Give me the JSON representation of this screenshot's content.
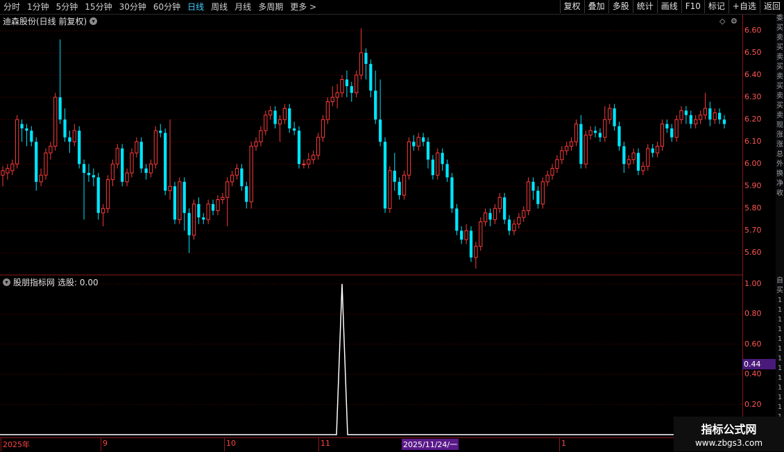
{
  "toolbar": {
    "periods": [
      "分时",
      "1分钟",
      "5分钟",
      "15分钟",
      "30分钟",
      "60分钟",
      "日线",
      "周线",
      "月线",
      "多周期",
      "更多"
    ],
    "active_period": "日线",
    "more_arrow": ">",
    "buttons": [
      "复权",
      "叠加",
      "多股",
      "统计",
      "画线",
      "F10",
      "标记",
      "+自选",
      "返回"
    ]
  },
  "main_chart": {
    "title": "迪森股份(日线 前复权)",
    "y_ticks": [
      "6.60",
      "6.50",
      "6.40",
      "6.30",
      "6.20",
      "6.10",
      "6.00",
      "5.90",
      "5.80",
      "5.70",
      "5.60"
    ]
  },
  "sub_chart": {
    "title": "股朋指标网",
    "indicator_label": "选股: 0.00",
    "y_ticks": [
      "1.00",
      "0.80",
      "0.60",
      "0.40",
      "0.20"
    ],
    "current_value": "0.44"
  },
  "x_axis": {
    "labels": [
      {
        "text": "2025年"
      },
      {
        "text": "9"
      },
      {
        "text": "10"
      },
      {
        "text": "11"
      },
      {
        "text": "1"
      }
    ],
    "selected_date": "2025/11/24/一"
  },
  "sidebar": {
    "chars": [
      "委",
      "买",
      "卖",
      "买",
      "卖",
      "买",
      "卖",
      "买",
      "卖",
      "买",
      "卖",
      "现",
      "涨",
      "涨",
      "总",
      "外",
      "换",
      "净",
      "收"
    ],
    "sub_chars": [
      "自",
      "买",
      "1",
      "1",
      "1",
      "1",
      "1",
      "1",
      "1",
      "1",
      "1",
      "1",
      "1",
      "1",
      "1",
      "1",
      "1"
    ]
  },
  "watermark": {
    "title": "指标公式网",
    "url": "www.zbgs3.com"
  },
  "colors": {
    "up": "#ff3b3b",
    "down": "#00e5ff",
    "signal": "#ffffff",
    "grid": "#6b0000"
  },
  "chart_data": {
    "type": "candlestick",
    "y_range": [
      5.52,
      6.65
    ],
    "candles": [
      [
        5.95,
        5.97,
        5.9,
        5.99
      ],
      [
        5.96,
        5.98,
        5.93,
        6.0
      ],
      [
        5.97,
        6.0,
        5.95,
        6.02
      ],
      [
        6.0,
        6.2,
        5.98,
        6.22
      ],
      [
        6.18,
        6.16,
        6.1,
        6.2
      ],
      [
        6.16,
        6.15,
        6.08,
        6.18
      ],
      [
        6.15,
        6.1,
        6.08,
        6.17
      ],
      [
        6.1,
        5.92,
        5.88,
        6.12
      ],
      [
        5.92,
        5.95,
        5.9,
        5.98
      ],
      [
        5.95,
        6.05,
        5.93,
        6.07
      ],
      [
        6.05,
        6.08,
        6.02,
        6.1
      ],
      [
        6.08,
        6.3,
        6.06,
        6.32
      ],
      [
        6.3,
        6.2,
        6.18,
        6.56
      ],
      [
        6.2,
        6.12,
        6.1,
        6.25
      ],
      [
        6.12,
        6.1,
        6.05,
        6.15
      ],
      [
        6.1,
        6.15,
        6.08,
        6.18
      ],
      [
        6.15,
        6.0,
        5.98,
        6.17
      ],
      [
        6.0,
        5.96,
        5.75,
        6.02
      ],
      [
        5.96,
        5.95,
        5.92,
        6.0
      ],
      [
        5.95,
        5.94,
        5.9,
        5.98
      ],
      [
        5.94,
        5.78,
        5.75,
        5.96
      ],
      [
        5.78,
        5.8,
        5.72,
        5.82
      ],
      [
        5.8,
        5.93,
        5.78,
        5.95
      ],
      [
        5.93,
        6.0,
        5.9,
        6.02
      ],
      [
        6.0,
        6.07,
        5.98,
        6.09
      ],
      [
        6.07,
        5.92,
        5.9,
        6.09
      ],
      [
        5.92,
        5.96,
        5.9,
        5.98
      ],
      [
        5.96,
        6.05,
        5.94,
        6.07
      ],
      [
        6.05,
        6.1,
        6.03,
        6.12
      ],
      [
        6.1,
        5.98,
        5.96,
        6.12
      ],
      [
        5.98,
        5.96,
        5.93,
        6.0
      ],
      [
        5.96,
        6.0,
        5.94,
        6.02
      ],
      [
        6.0,
        6.15,
        5.98,
        6.17
      ],
      [
        6.15,
        6.14,
        6.12,
        6.18
      ],
      [
        6.14,
        5.88,
        5.86,
        6.16
      ],
      [
        5.88,
        5.9,
        5.84,
        6.2
      ],
      [
        5.9,
        5.75,
        5.73,
        5.92
      ],
      [
        5.75,
        5.92,
        5.73,
        5.94
      ],
      [
        5.92,
        5.78,
        5.7,
        5.94
      ],
      [
        5.78,
        5.68,
        5.6,
        5.8
      ],
      [
        5.68,
        5.82,
        5.66,
        5.84
      ],
      [
        5.82,
        5.76,
        5.73,
        5.85
      ],
      [
        5.76,
        5.75,
        5.73,
        5.78
      ],
      [
        5.75,
        5.82,
        5.73,
        5.84
      ],
      [
        5.82,
        5.79,
        5.77,
        5.84
      ],
      [
        5.79,
        5.84,
        5.77,
        5.86
      ],
      [
        5.84,
        5.85,
        5.82,
        5.87
      ],
      [
        5.85,
        5.92,
        5.72,
        5.94
      ],
      [
        5.92,
        5.95,
        5.9,
        5.97
      ],
      [
        5.95,
        5.98,
        5.93,
        6.0
      ],
      [
        5.98,
        5.9,
        5.88,
        6.0
      ],
      [
        5.9,
        5.83,
        5.8,
        5.92
      ],
      [
        5.83,
        6.08,
        5.8,
        6.1
      ],
      [
        6.08,
        6.1,
        6.06,
        6.12
      ],
      [
        6.1,
        6.15,
        6.08,
        6.17
      ],
      [
        6.15,
        6.22,
        6.13,
        6.24
      ],
      [
        6.22,
        6.24,
        6.2,
        6.26
      ],
      [
        6.24,
        6.18,
        6.16,
        6.26
      ],
      [
        6.18,
        6.2,
        6.1,
        6.22
      ],
      [
        6.2,
        6.25,
        6.18,
        6.27
      ],
      [
        6.25,
        6.16,
        6.14,
        6.27
      ],
      [
        6.16,
        6.15,
        6.13,
        6.19
      ],
      [
        6.15,
        6.0,
        5.98,
        6.17
      ],
      [
        6.0,
        6.0,
        5.98,
        6.02
      ],
      [
        6.0,
        6.02,
        5.98,
        6.05
      ],
      [
        6.02,
        6.04,
        6.0,
        6.06
      ],
      [
        6.04,
        6.12,
        6.02,
        6.14
      ],
      [
        6.12,
        6.2,
        6.1,
        6.22
      ],
      [
        6.2,
        6.28,
        6.18,
        6.3
      ],
      [
        6.28,
        6.3,
        6.26,
        6.35
      ],
      [
        6.3,
        6.32,
        6.25,
        6.36
      ],
      [
        6.32,
        6.38,
        6.3,
        6.4
      ],
      [
        6.38,
        6.35,
        6.3,
        6.42
      ],
      [
        6.35,
        6.32,
        6.28,
        6.37
      ],
      [
        6.32,
        6.4,
        6.3,
        6.42
      ],
      [
        6.4,
        6.5,
        6.38,
        6.61
      ],
      [
        6.5,
        6.45,
        6.38,
        6.52
      ],
      [
        6.45,
        6.33,
        6.3,
        6.47
      ],
      [
        6.33,
        6.2,
        6.18,
        6.42
      ],
      [
        6.2,
        6.1,
        6.08,
        6.38
      ],
      [
        6.1,
        5.8,
        5.78,
        6.12
      ],
      [
        5.8,
        5.97,
        5.78,
        5.99
      ],
      [
        5.97,
        5.92,
        5.88,
        6.05
      ],
      [
        5.92,
        5.86,
        5.84,
        5.94
      ],
      [
        5.86,
        5.95,
        5.84,
        5.97
      ],
      [
        5.95,
        6.1,
        5.93,
        6.12
      ],
      [
        6.1,
        6.08,
        6.06,
        6.13
      ],
      [
        6.08,
        6.12,
        6.06,
        6.14
      ],
      [
        6.12,
        6.1,
        6.08,
        6.14
      ],
      [
        6.1,
        6.02,
        5.98,
        6.12
      ],
      [
        6.02,
        5.95,
        5.93,
        6.04
      ],
      [
        5.95,
        6.05,
        5.93,
        6.07
      ],
      [
        6.05,
        6.0,
        5.97,
        6.07
      ],
      [
        6.0,
        5.94,
        5.92,
        6.02
      ],
      [
        5.94,
        5.8,
        5.78,
        5.96
      ],
      [
        5.8,
        5.7,
        5.68,
        5.82
      ],
      [
        5.7,
        5.66,
        5.64,
        5.72
      ],
      [
        5.66,
        5.7,
        5.64,
        5.73
      ],
      [
        5.7,
        5.58,
        5.56,
        5.72
      ],
      [
        5.58,
        5.63,
        5.53,
        5.65
      ],
      [
        5.63,
        5.74,
        5.61,
        5.76
      ],
      [
        5.74,
        5.78,
        5.72,
        5.8
      ],
      [
        5.78,
        5.75,
        5.72,
        5.8
      ],
      [
        5.75,
        5.8,
        5.73,
        5.82
      ],
      [
        5.8,
        5.85,
        5.78,
        5.87
      ],
      [
        5.85,
        5.75,
        5.73,
        5.87
      ],
      [
        5.75,
        5.7,
        5.68,
        5.77
      ],
      [
        5.7,
        5.73,
        5.68,
        5.75
      ],
      [
        5.73,
        5.76,
        5.71,
        5.78
      ],
      [
        5.76,
        5.79,
        5.74,
        5.81
      ],
      [
        5.79,
        5.92,
        5.77,
        5.94
      ],
      [
        5.92,
        5.88,
        5.84,
        5.94
      ],
      [
        5.88,
        5.82,
        5.8,
        5.9
      ],
      [
        5.82,
        5.92,
        5.8,
        5.94
      ],
      [
        5.92,
        5.95,
        5.9,
        5.97
      ],
      [
        5.95,
        5.98,
        5.93,
        6.0
      ],
      [
        5.98,
        6.02,
        5.96,
        6.04
      ],
      [
        6.02,
        6.06,
        6.0,
        6.08
      ],
      [
        6.06,
        6.08,
        6.04,
        6.1
      ],
      [
        6.08,
        6.1,
        6.06,
        6.12
      ],
      [
        6.1,
        6.18,
        6.08,
        6.2
      ],
      [
        6.18,
        6.0,
        5.98,
        6.22
      ],
      [
        6.0,
        6.13,
        5.98,
        6.15
      ],
      [
        6.13,
        6.15,
        6.11,
        6.17
      ],
      [
        6.15,
        6.14,
        6.12,
        6.17
      ],
      [
        6.14,
        6.12,
        6.1,
        6.16
      ],
      [
        6.12,
        6.2,
        6.1,
        6.26
      ],
      [
        6.2,
        6.25,
        6.18,
        6.27
      ],
      [
        6.25,
        6.17,
        6.15,
        6.27
      ],
      [
        6.17,
        6.08,
        6.06,
        6.19
      ],
      [
        6.08,
        6.0,
        5.96,
        6.1
      ],
      [
        6.0,
        6.02,
        5.98,
        6.04
      ],
      [
        6.02,
        6.05,
        6.0,
        6.07
      ],
      [
        6.05,
        5.97,
        5.95,
        6.07
      ],
      [
        5.97,
        5.99,
        5.95,
        6.01
      ],
      [
        5.99,
        6.07,
        5.97,
        6.09
      ],
      [
        6.07,
        6.05,
        6.03,
        6.09
      ],
      [
        6.05,
        6.08,
        6.03,
        6.1
      ],
      [
        6.08,
        6.18,
        6.06,
        6.2
      ],
      [
        6.18,
        6.16,
        6.14,
        6.2
      ],
      [
        6.16,
        6.12,
        6.1,
        6.18
      ],
      [
        6.12,
        6.2,
        6.1,
        6.22
      ],
      [
        6.2,
        6.24,
        6.18,
        6.26
      ],
      [
        6.24,
        6.22,
        6.18,
        6.26
      ],
      [
        6.22,
        6.18,
        6.16,
        6.24
      ],
      [
        6.18,
        6.2,
        6.16,
        6.22
      ],
      [
        6.2,
        6.22,
        6.18,
        6.24
      ],
      [
        6.22,
        6.25,
        6.2,
        6.32
      ],
      [
        6.25,
        6.2,
        6.17,
        6.28
      ],
      [
        6.2,
        6.23,
        6.18,
        6.25
      ],
      [
        6.23,
        6.2,
        6.18,
        6.25
      ],
      [
        6.2,
        6.18,
        6.16,
        6.22
      ]
    ],
    "indicator": {
      "name": "选股",
      "signal_index": 71,
      "y_range": [
        0,
        1.05
      ]
    }
  }
}
